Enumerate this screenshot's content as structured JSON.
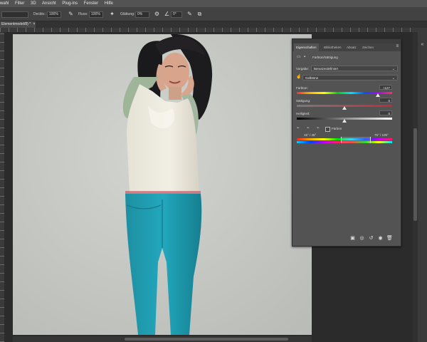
{
  "menubar": {
    "items": [
      "wahl",
      "Filter",
      "3D",
      "Ansicht",
      "Plug-ins",
      "Fenster",
      "Hilfe"
    ]
  },
  "options": {
    "mode_value": "",
    "opacity_label": "Deckkr.:",
    "opacity_value": "100%",
    "flow_label": "Fluss:",
    "flow_value": "100%",
    "smoothing_label": "Glättung:",
    "smoothing_value": "0%",
    "angle_value": "0°"
  },
  "document": {
    "tab_label": "Elementmodel/8) *",
    "close": "×"
  },
  "panel": {
    "tabs": [
      "Eigenschaften",
      "Bibliotheken",
      "Absatz",
      "Zeichen"
    ],
    "menu_glyph": "≡",
    "adjustment_title": "Farbton/Sättigung",
    "preset_label": "Vorgabe:",
    "preset_value": "Benutzerdefiniert",
    "channel_value": "Gelbtöne",
    "hue_label": "Farbton:",
    "hue_value": "+127",
    "hue_fraction": 0.85,
    "saturation_label": "Sättigung:",
    "saturation_value": "0",
    "saturation_fraction": 0.5,
    "lightness_label": "Helligkeit:",
    "lightness_value": "0",
    "lightness_fraction": 0.5,
    "colorize_label": "Färben",
    "range_left": "15° / 45°",
    "range_right": "75° / 105°"
  },
  "colors": {
    "accent": "#1ea2b8",
    "panel_bg": "#535353",
    "app_bg": "#282828"
  }
}
